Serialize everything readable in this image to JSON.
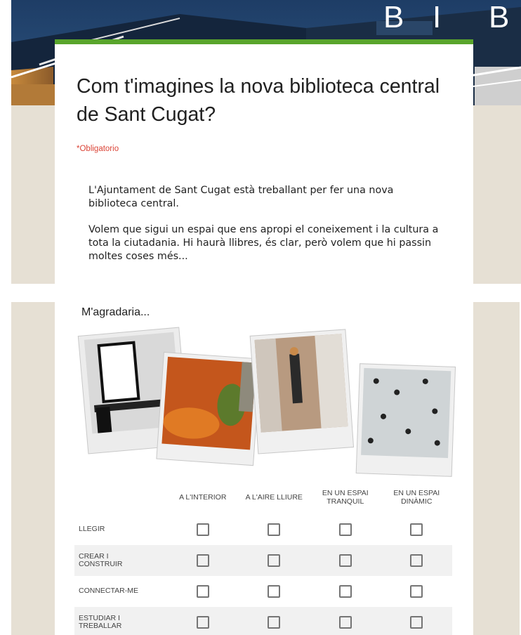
{
  "header": {
    "banner_letters": [
      "B",
      "I",
      "B"
    ],
    "title": "Com t'imagines la nova biblioteca central de Sant Cugat?",
    "required_note": "*Obligatorio",
    "description": [
      "L'Ajuntament de Sant Cugat està treballant per fer una nova biblioteca central.",
      "Volem que sigui un espai que ens apropi el coneixement i la cultura a tota la ciutadania. Hi haurà llibres, és clar, però volem que hi passin moltes coses més..."
    ]
  },
  "question": {
    "title": "M'agradaria...",
    "images": [
      "frame-poster-photo",
      "autumn-leaves-photo",
      "bookshelf-photo",
      "crowd-photo"
    ],
    "columns": [
      "A L'INTERIOR",
      "A L'AIRE LLIURE",
      "EN UN ESPAI TRANQUIL",
      "EN UN ESPAI DINÀMIC"
    ],
    "rows": [
      {
        "label": "LLEGIR",
        "checked": [
          false,
          false,
          false,
          false
        ]
      },
      {
        "label": "CREAR I CONSTRUIR",
        "checked": [
          false,
          false,
          false,
          false
        ]
      },
      {
        "label": "CONNECTAR-ME",
        "checked": [
          false,
          false,
          false,
          false
        ]
      },
      {
        "label": "ESTUDIAR I TREBALLAR",
        "checked": [
          false,
          false,
          false,
          false
        ]
      }
    ]
  },
  "colors": {
    "accent": "#59a52c",
    "required": "#db4437",
    "page_background": "#e6e0d4"
  }
}
